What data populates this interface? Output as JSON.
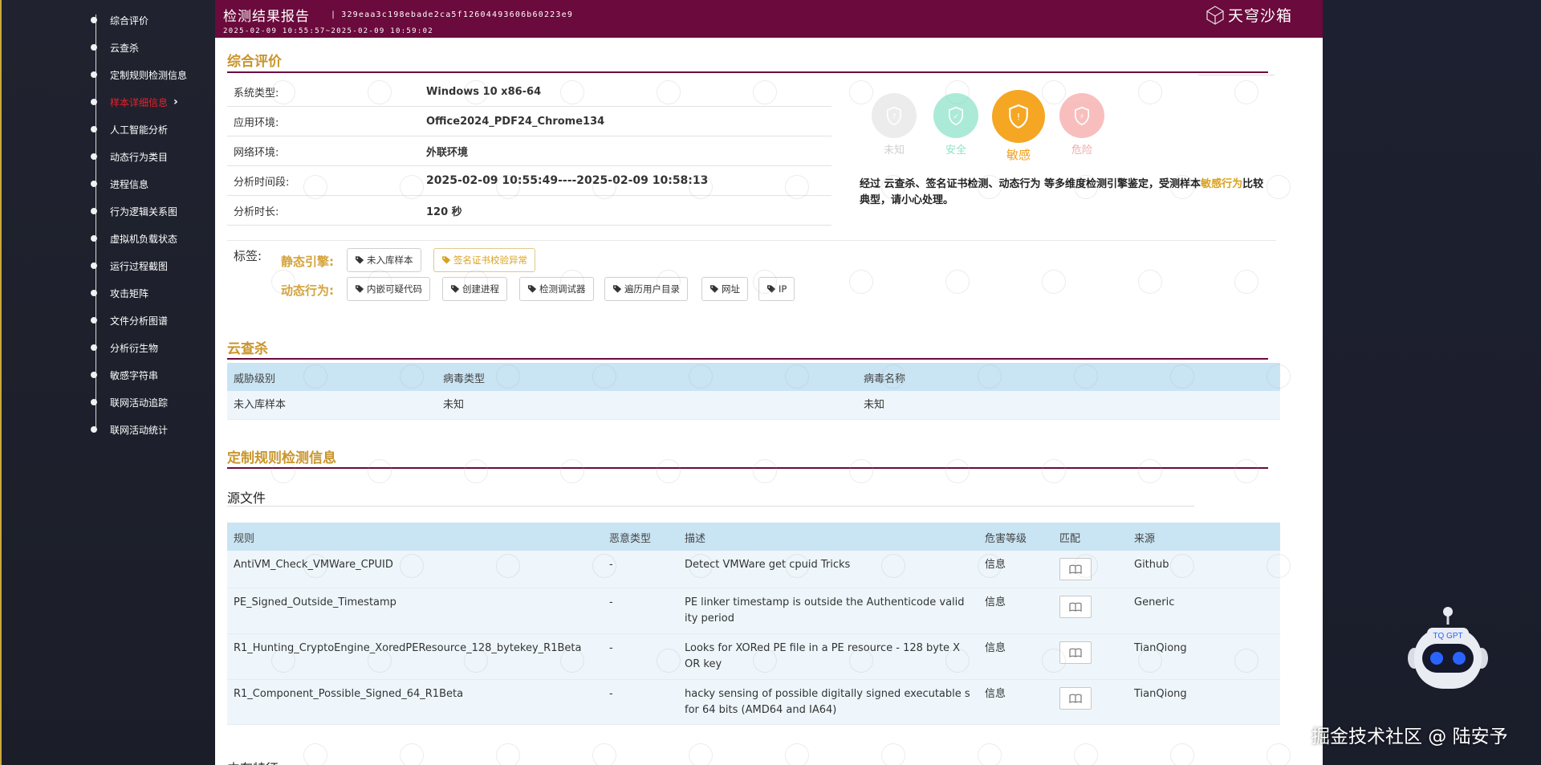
{
  "sidebar": {
    "items": [
      {
        "label": "综合评价"
      },
      {
        "label": "云查杀"
      },
      {
        "label": "定制规则检测信息"
      },
      {
        "label": "样本详细信息"
      },
      {
        "label": "人工智能分析"
      },
      {
        "label": "动态行为类目"
      },
      {
        "label": "进程信息"
      },
      {
        "label": "行为逻辑关系图"
      },
      {
        "label": "虚拟机负载状态"
      },
      {
        "label": "运行过程截图"
      },
      {
        "label": "攻击矩阵"
      },
      {
        "label": "文件分析图谱"
      },
      {
        "label": "分析衍生物"
      },
      {
        "label": "敏感字符串"
      },
      {
        "label": "联网活动追踪"
      },
      {
        "label": "联网活动统计"
      }
    ],
    "active_item": "样本详细信息",
    "active_color": "#e8202a"
  },
  "header": {
    "title": "检测结果报告",
    "separator": "|",
    "hash": "329eaa3c198ebade2ca5f12604493606b60223e9",
    "time_range": "2025-02-09 10:55:57~2025-02-09 10:59:02",
    "brand": "天穹沙箱",
    "bg_color": "#6b0a3c"
  },
  "overview": {
    "title": "综合评价",
    "rows": [
      {
        "label": "系统类型:",
        "value": "Windows 10 x86-64"
      },
      {
        "label": "应用环境:",
        "value": "Office2024_PDF24_Chrome134"
      },
      {
        "label": "网络环境:",
        "value": "外联环境"
      },
      {
        "label": "分析时间段:",
        "value": "2025-02-09 10:55:49----2025-02-09 10:58:13"
      },
      {
        "label": "分析时长:",
        "value": "120 秒"
      }
    ],
    "verdicts": [
      {
        "label": "未知",
        "icon": "question-shield-icon",
        "color": "#e6e6e6"
      },
      {
        "label": "安全",
        "icon": "check-shield-icon",
        "color": "#8fe3c9"
      },
      {
        "label": "敏感",
        "icon": "exclamation-shield-icon",
        "color": "#f5a623",
        "selected": true
      },
      {
        "label": "危险",
        "icon": "bolt-shield-icon",
        "color": "#f6a9a9"
      }
    ],
    "verdict_text": {
      "prefix": "经过 云查杀、签名证书检测、动态行为 等多维度检测引擎鉴定，受测样本",
      "highlight": "敏感行为",
      "suffix": "比较典型，请小心处理。"
    },
    "tags": {
      "label": "标签:",
      "static_label": "静态引擎:",
      "static": [
        {
          "text": "未入库样本",
          "warn": false
        },
        {
          "text": "签名证书校验异常",
          "warn": true
        }
      ],
      "dynamic_label": "动态行为:",
      "dynamic": [
        {
          "text": "内嵌可疑代码"
        },
        {
          "text": "创建进程"
        },
        {
          "text": "检测调试器"
        },
        {
          "text": "遍历用户目录"
        },
        {
          "text": "网址"
        },
        {
          "text": "IP"
        }
      ]
    }
  },
  "cloud": {
    "title": "云查杀",
    "columns": [
      "威胁级别",
      "病毒类型",
      "病毒名称"
    ],
    "rows": [
      [
        "未入库样本",
        "未知",
        "未知"
      ]
    ]
  },
  "custom_rules": {
    "title": "定制规则检测信息",
    "subtitle": "源文件",
    "columns": [
      "规则",
      "恶意类型",
      "描述",
      "危害等级",
      "匹配",
      "来源"
    ],
    "rows": [
      {
        "rule": "AntiVM_Check_VMWare_CPUID",
        "type": "-",
        "desc": "Detect VMWare get cpuid Tricks",
        "level": "信息",
        "source": "Github"
      },
      {
        "rule": "PE_Signed_Outside_Timestamp",
        "type": "-",
        "desc": "PE linker timestamp is outside the Authenticode valid ity period",
        "level": "信息",
        "source": "Generic"
      },
      {
        "rule": "R1_Hunting_CryptoEngine_XoredPEResource_128_bytekey_R1Beta",
        "type": "-",
        "desc": "Looks for XORed PE file in a PE resource - 128 byte X OR key",
        "level": "信息",
        "source": "TianQiong"
      },
      {
        "rule": "R1_Component_Possible_Signed_64_R1Beta",
        "type": "-",
        "desc": "hacky sensing of possible digitally signed executable s for 64 bits (AMD64 and IA64)",
        "level": "信息",
        "source": "TianQiong"
      }
    ],
    "next_section_cut": "内存特征"
  },
  "assistant": {
    "label": "TQ GPT"
  },
  "watermark": "掘金技术社区 @ 陆安予"
}
